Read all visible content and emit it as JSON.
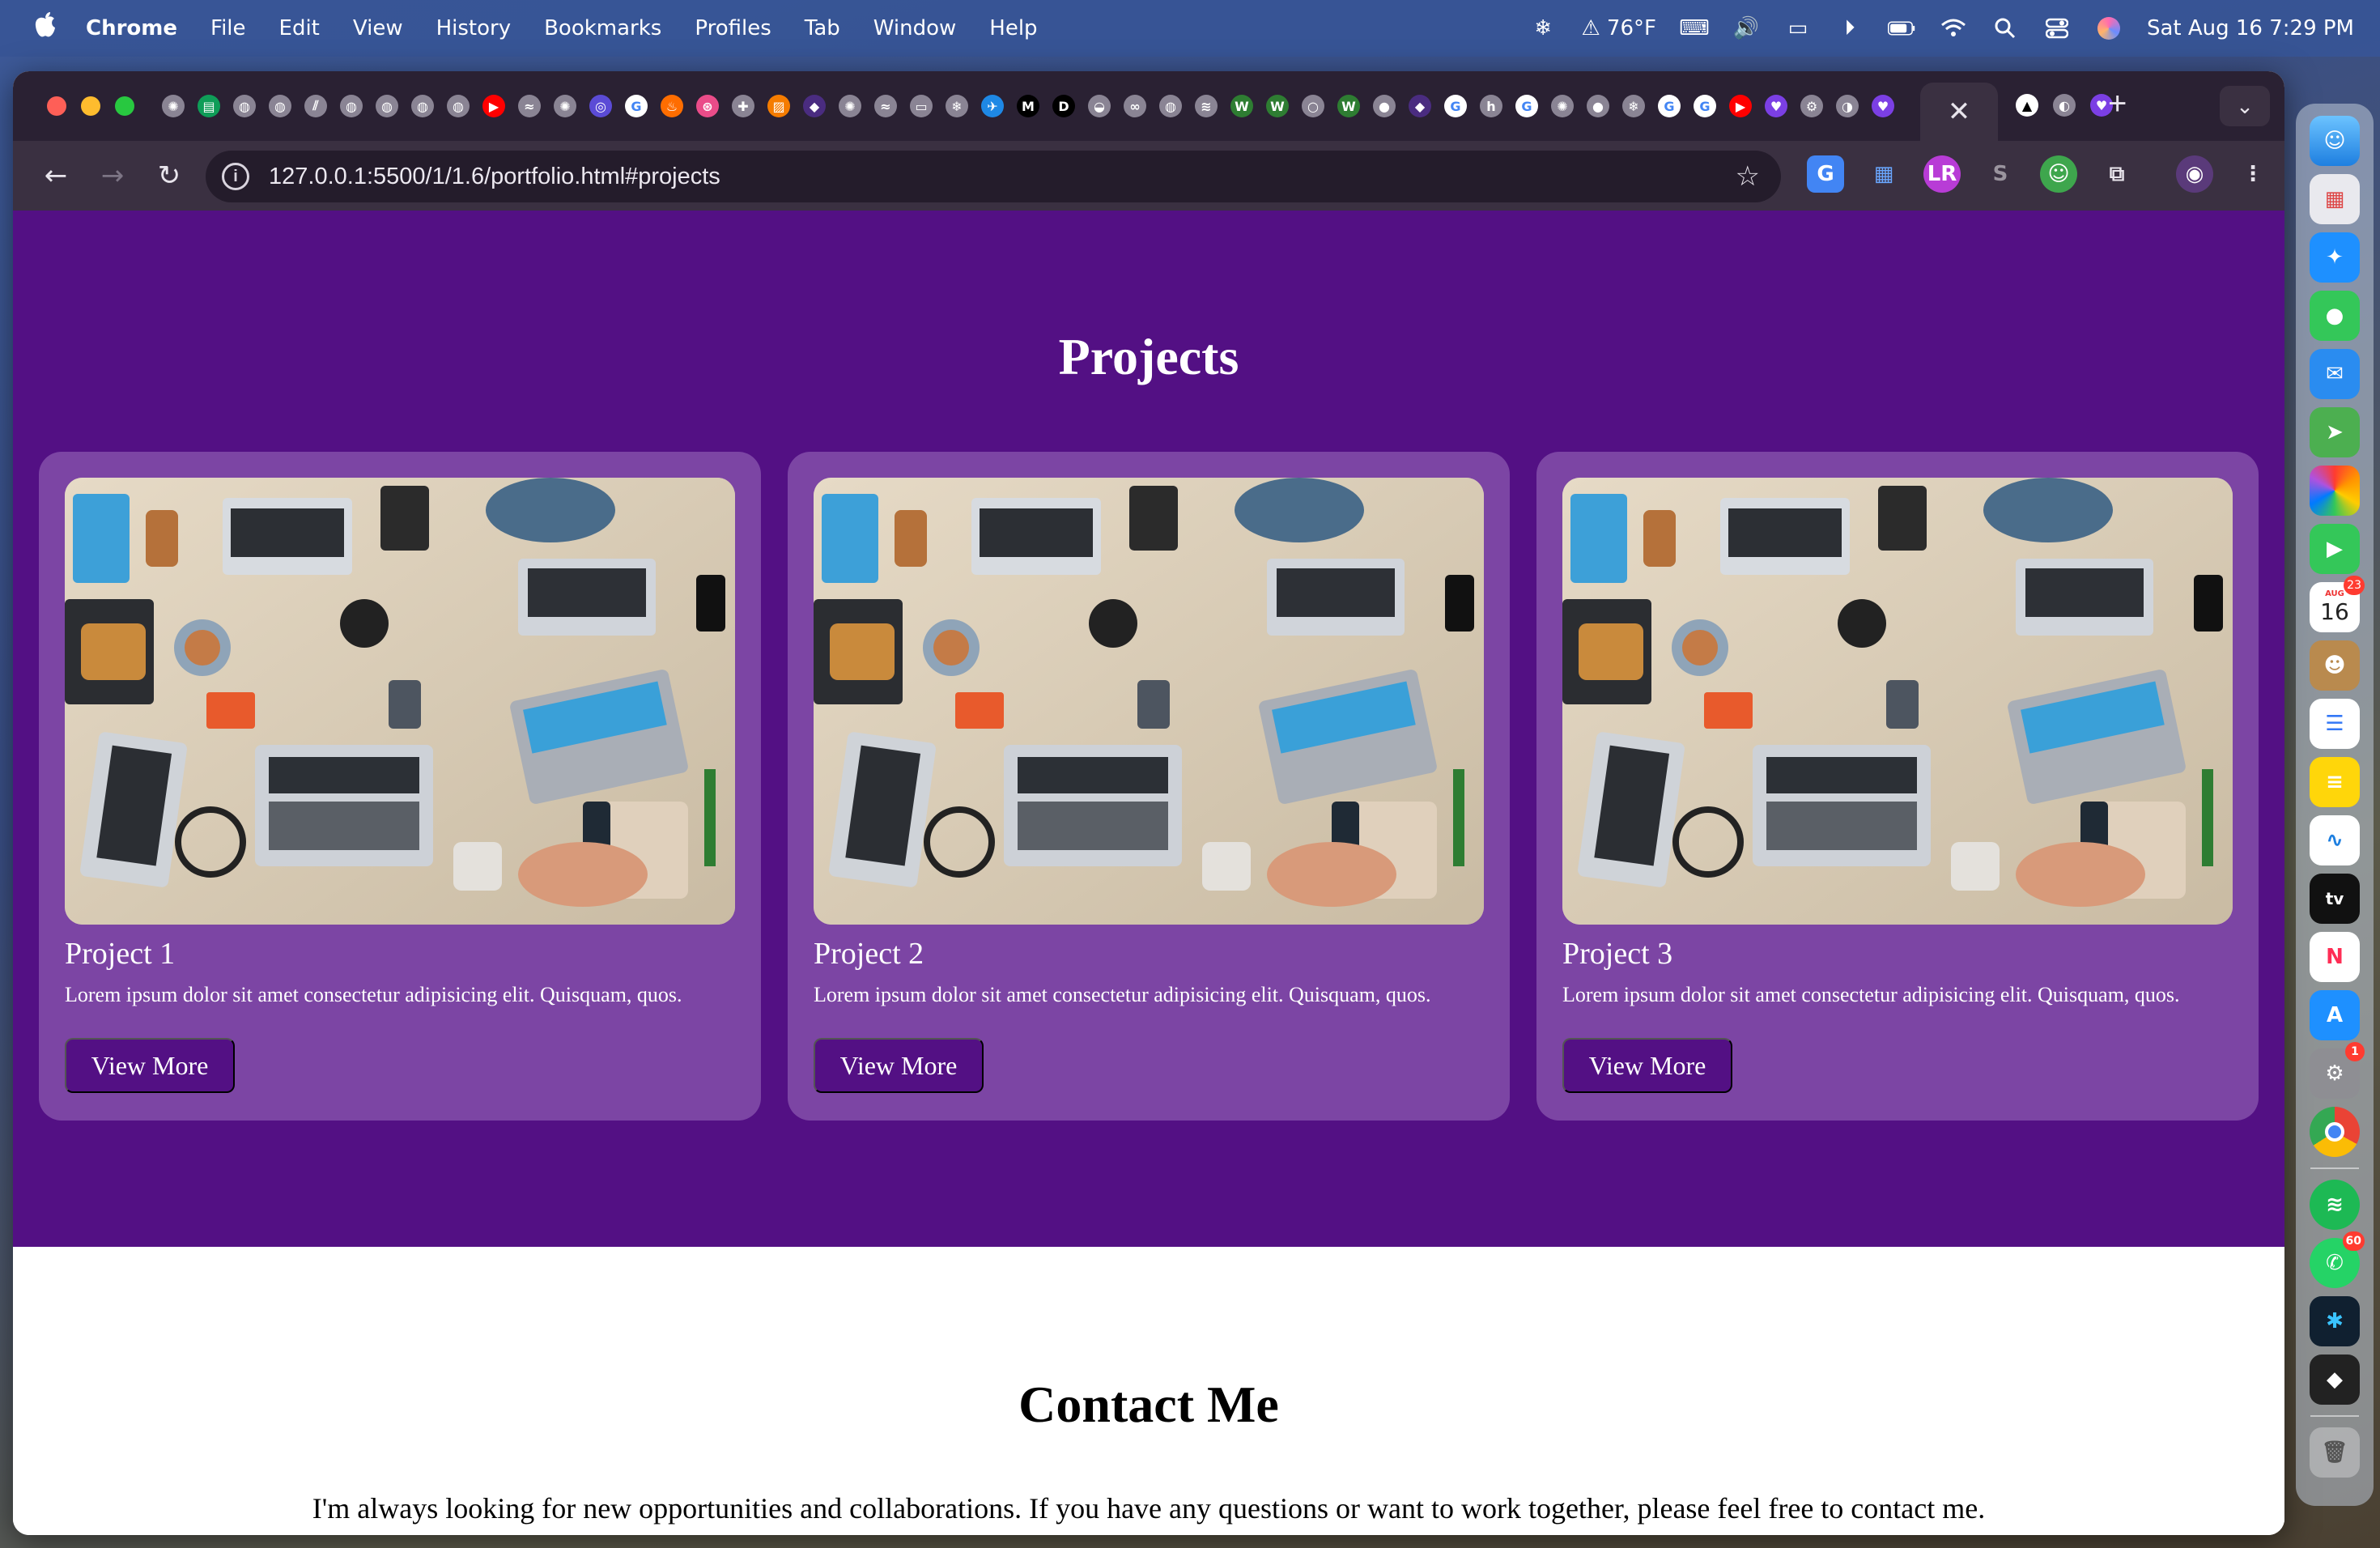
{
  "menubar": {
    "app_name": "Chrome",
    "menus": [
      "File",
      "Edit",
      "View",
      "History",
      "Bookmarks",
      "Profiles",
      "Tab",
      "Window",
      "Help"
    ],
    "weather": "76°F",
    "datetime": "Sat Aug 16  7:29 PM"
  },
  "browser": {
    "url": "127.0.0.1:5500/1/1.6/portfolio.html#projects",
    "tab_favicons": [
      "chatgpt-icon",
      "sheets-icon",
      "globe-icon",
      "globe-icon",
      "stripes-icon",
      "globe-icon",
      "globe-icon",
      "globe-icon",
      "globe-icon",
      "youtube-icon",
      "wind-icon",
      "chatgpt-icon",
      "ring-icon",
      "google-icon",
      "fire-icon",
      "dribbble-icon",
      "puzzle-icon",
      "photo-icon",
      "shield-icon",
      "chatgpt-icon",
      "wind-icon",
      "terminal-icon",
      "snowflake-icon",
      "plane-icon",
      "medium-icon",
      "dev-icon",
      "whale-icon",
      "infinity-icon",
      "globe-icon",
      "layers-icon",
      "w-icon",
      "w-icon",
      "circle-icon",
      "w-icon",
      "github-icon",
      "shield-icon",
      "google-icon",
      "h-icon",
      "google-icon",
      "chatgpt-icon",
      "github-icon",
      "snowflake-icon",
      "google-icon",
      "google-icon",
      "youtube-icon",
      "heart-icon",
      "gear-icon",
      "toggle-icon",
      "heart-icon"
    ],
    "active_tab_close": "✕",
    "new_tab": "+"
  },
  "page": {
    "projects_heading": "Projects",
    "projects": [
      {
        "title": "Project 1",
        "description": "Lorem ipsum dolor sit amet consectetur adipisicing elit. Quisquam, quos.",
        "button": "View More"
      },
      {
        "title": "Project 2",
        "description": "Lorem ipsum dolor sit amet consectetur adipisicing elit. Quisquam, quos.",
        "button": "View More"
      },
      {
        "title": "Project 3",
        "description": "Lorem ipsum dolor sit amet consectetur adipisicing elit. Quisquam, quos.",
        "button": "View More"
      }
    ],
    "contact_heading": "Contact Me",
    "contact_text": "I'm always looking for new opportunities and collaborations. If you have any questions or want to work together, please feel free to contact me."
  },
  "dock": {
    "calendar_month": "AUG",
    "calendar_day": "16",
    "calendar_badge": "23",
    "settings_badge": "1",
    "whatsapp_badge": "60"
  },
  "colors": {
    "projects_bg": "#531084",
    "card_bg": "#7c45a4",
    "button_bg": "#531084"
  }
}
